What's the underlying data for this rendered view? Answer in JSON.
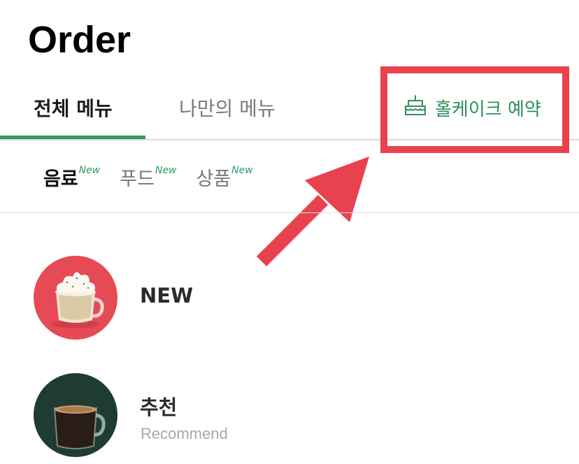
{
  "header": {
    "title": "Order"
  },
  "tabs": {
    "all_menu": "전체 메뉴",
    "my_menu": "나만의 메뉴",
    "active": "all_menu"
  },
  "cake_reservation": {
    "label": "홀케이크 예약",
    "icon": "cake-icon"
  },
  "subcategories": [
    {
      "label": "음료",
      "badge": "New",
      "active": true
    },
    {
      "label": "푸드",
      "badge": "New",
      "active": false
    },
    {
      "label": "상품",
      "badge": "New",
      "active": false
    }
  ],
  "menu_list": [
    {
      "title": "NEW",
      "subtitle": ""
    },
    {
      "title": "추천",
      "subtitle": "Recommend"
    }
  ],
  "colors": {
    "accent": "#2e9b62",
    "highlight": "#e8424e",
    "new_thumb_bg": "#e64a55",
    "rec_thumb_bg": "#1f3c33"
  }
}
